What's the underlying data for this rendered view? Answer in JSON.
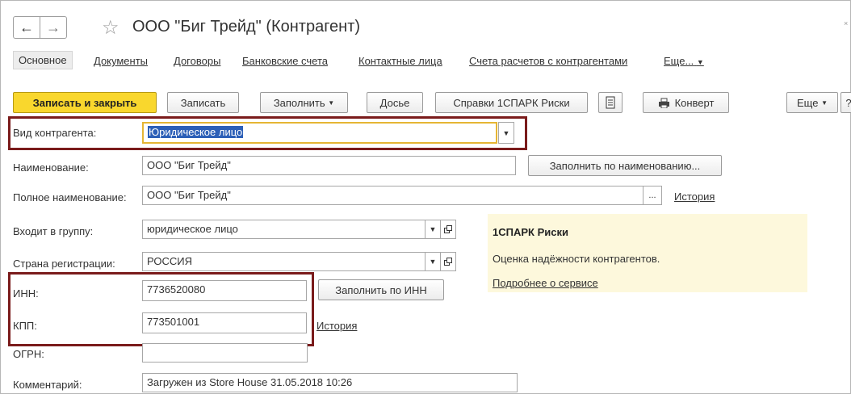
{
  "window": {
    "title": "ООО \"Биг Трейд\" (Контрагент)"
  },
  "nav": {
    "back_icon": "←",
    "forward_icon": "→",
    "star_icon": "☆"
  },
  "tabs": [
    "Основное",
    "Документы",
    "Договоры",
    "Банковские счета",
    "Контактные лица",
    "Счета расчетов с контрагентами",
    "Еще..."
  ],
  "toolbar": {
    "save_close": "Записать и закрыть",
    "save": "Записать",
    "fill": "Заполнить",
    "dossier": "Досье",
    "spark_refs": "Справки 1СПАРК Риски",
    "envelope": "Конверт",
    "more": "Еще",
    "help": "?"
  },
  "form": {
    "kind": {
      "label": "Вид контрагента:",
      "value": "Юридическое лицо"
    },
    "name": {
      "label": "Наименование:",
      "value": "ООО \"Биг Трейд\"",
      "button": "Заполнить по наименованию..."
    },
    "full_name": {
      "label": "Полное наименование:",
      "value": "ООО \"Биг Трейд\"",
      "ellipsis": "...",
      "history": "История"
    },
    "group": {
      "label": "Входит в группу:",
      "value": "юридическое лицо"
    },
    "country": {
      "label": "Страна регистрации:",
      "value": "РОССИЯ"
    },
    "inn": {
      "label": "ИНН:",
      "value": "7736520080",
      "button": "Заполнить по ИНН"
    },
    "kpp": {
      "label": "КПП:",
      "value": "773501001",
      "history": "История"
    },
    "ogrn": {
      "label": "ОГРН:",
      "value": ""
    },
    "comment": {
      "label": "Комментарий:",
      "value": "Загружен из Store House 31.05.2018 10:26"
    }
  },
  "spark_panel": {
    "title": "1СПАРК Риски",
    "text": "Оценка надёжности контрагентов.",
    "link": "Подробнее о сервисе",
    "bg_color": "#fdf8dc"
  },
  "colors": {
    "accent_button": "#f9d72d",
    "highlight_box": "#7a1b1b",
    "selection": "#2c5fb7"
  }
}
